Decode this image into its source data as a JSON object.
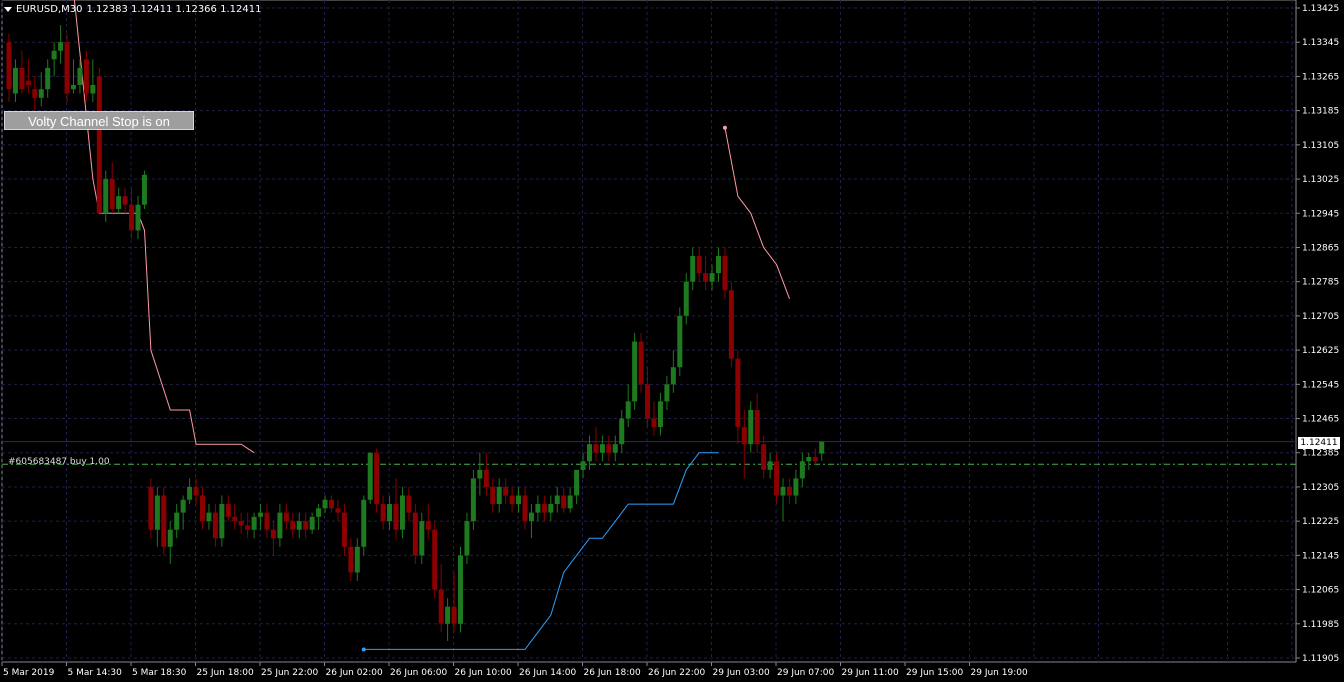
{
  "header": {
    "symbol": "EURUSD,M30",
    "ohlc": "1.12383 1.12411 1.12366 1.12411"
  },
  "indicator_button": {
    "label": "Volty Channel Stop is on"
  },
  "order": {
    "label": "#605683487 buy 1.00",
    "price": 1.12358
  },
  "current_price": {
    "label": "1.12411",
    "value": 1.12411
  },
  "colors": {
    "background": "#000000",
    "grid": "#202046",
    "bull": "#1e7a1e",
    "bear": "#8b0000",
    "upper_stop": "#ff9aa2",
    "lower_stop": "#2aa0ff",
    "order_line": "#4caf50",
    "price_line": "#2a2a6a",
    "axis_text": "#ffffff"
  },
  "chart_data": {
    "type": "candlestick",
    "symbol": "EURUSD",
    "timeframe": "M30",
    "ylim": [
      1.11885,
      1.13465
    ],
    "y_ticks": [
      "1.13425",
      "1.13345",
      "1.13265",
      "1.13185",
      "1.13105",
      "1.13025",
      "1.12945",
      "1.12865",
      "1.12785",
      "1.12705",
      "1.12625",
      "1.12545",
      "1.12465",
      "1.12385",
      "1.12305",
      "1.12225",
      "1.12145",
      "1.12065",
      "1.11985",
      "1.11905"
    ],
    "x_ticks": [
      "5 Mar 2019",
      "5 Mar 14:30",
      "5 Mar 18:30",
      "25 Jun 18:00",
      "25 Jun 22:00",
      "26 Jun 02:00",
      "26 Jun 06:00",
      "26 Jun 10:00",
      "26 Jun 14:00",
      "26 Jun 18:00",
      "26 Jun 22:00",
      "29 Jun 03:00",
      "29 Jun 07:00",
      "29 Jun 11:00",
      "29 Jun 15:00",
      "29 Jun 19:00"
    ],
    "grid": true,
    "candles": [
      [
        1.13345,
        1.13365,
        1.13205,
        1.13235
      ],
      [
        1.13225,
        1.13305,
        1.13205,
        1.13285
      ],
      [
        1.13285,
        1.13325,
        1.13225,
        1.13235
      ],
      [
        1.13255,
        1.13305,
        1.13225,
        1.13245
      ],
      [
        1.13235,
        1.13265,
        1.13185,
        1.13215
      ],
      [
        1.13215,
        1.13275,
        1.13195,
        1.13235
      ],
      [
        1.13235,
        1.13305,
        1.13215,
        1.13285
      ],
      [
        1.13305,
        1.13345,
        1.13265,
        1.13325
      ],
      [
        1.13325,
        1.13385,
        1.13295,
        1.13345
      ],
      [
        1.13345,
        1.13365,
        1.13205,
        1.13225
      ],
      [
        1.13235,
        1.13305,
        1.13225,
        1.13245
      ],
      [
        1.13245,
        1.13305,
        1.13225,
        1.13285
      ],
      [
        1.13305,
        1.13325,
        1.13205,
        1.13225
      ],
      [
        1.13225,
        1.13305,
        1.13205,
        1.13245
      ],
      [
        1.13265,
        1.13285,
        1.12945,
        1.12945
      ],
      [
        1.12945,
        1.13045,
        1.12925,
        1.13025
      ],
      [
        1.13025,
        1.13065,
        1.12945,
        1.12955
      ],
      [
        1.12955,
        1.13005,
        1.12945,
        1.12985
      ],
      [
        1.12985,
        1.13005,
        1.12945,
        1.12965
      ],
      [
        1.12965,
        1.13005,
        1.12885,
        1.12905
      ],
      [
        1.12905,
        1.12985,
        1.12885,
        1.12965
      ],
      [
        1.12965,
        1.13045,
        1.12955,
        1.13035
      ],
      [
        1.12305,
        1.12325,
        1.12185,
        1.12205
      ],
      [
        1.12205,
        1.12305,
        1.12165,
        1.12285
      ],
      [
        1.12285,
        1.12305,
        1.12145,
        1.12165
      ],
      [
        1.12165,
        1.12225,
        1.12125,
        1.12205
      ],
      [
        1.12205,
        1.12265,
        1.12185,
        1.12245
      ],
      [
        1.12245,
        1.12285,
        1.12205,
        1.12275
      ],
      [
        1.12275,
        1.12325,
        1.12265,
        1.12305
      ],
      [
        1.12305,
        1.12325,
        1.12265,
        1.12285
      ],
      [
        1.12285,
        1.12305,
        1.12205,
        1.12225
      ],
      [
        1.12225,
        1.12265,
        1.12205,
        1.12245
      ],
      [
        1.12245,
        1.12265,
        1.12165,
        1.12185
      ],
      [
        1.12185,
        1.12285,
        1.12165,
        1.12265
      ],
      [
        1.12265,
        1.12285,
        1.12225,
        1.12235
      ],
      [
        1.12235,
        1.12265,
        1.12205,
        1.12225
      ],
      [
        1.12225,
        1.12245,
        1.12195,
        1.12215
      ],
      [
        1.12215,
        1.12245,
        1.12185,
        1.12205
      ],
      [
        1.12205,
        1.12245,
        1.12185,
        1.12235
      ],
      [
        1.12235,
        1.12265,
        1.12205,
        1.12245
      ],
      [
        1.12245,
        1.12265,
        1.12185,
        1.12205
      ],
      [
        1.12205,
        1.12225,
        1.12145,
        1.12185
      ],
      [
        1.12185,
        1.12265,
        1.12165,
        1.12245
      ],
      [
        1.12245,
        1.12265,
        1.12205,
        1.12225
      ],
      [
        1.12225,
        1.12245,
        1.12185,
        1.12205
      ],
      [
        1.12205,
        1.12245,
        1.12185,
        1.12225
      ],
      [
        1.12225,
        1.12245,
        1.12185,
        1.12205
      ],
      [
        1.12205,
        1.12245,
        1.12195,
        1.12235
      ],
      [
        1.12235,
        1.12265,
        1.12205,
        1.12255
      ],
      [
        1.12255,
        1.12285,
        1.12245,
        1.12275
      ],
      [
        1.12275,
        1.12285,
        1.12245,
        1.12255
      ],
      [
        1.12255,
        1.12275,
        1.12225,
        1.12245
      ],
      [
        1.12245,
        1.12265,
        1.12145,
        1.12165
      ],
      [
        1.12165,
        1.12185,
        1.12085,
        1.12105
      ],
      [
        1.12105,
        1.12185,
        1.12085,
        1.12165
      ],
      [
        1.12165,
        1.12285,
        1.12145,
        1.12275
      ],
      [
        1.12275,
        1.12385,
        1.12265,
        1.12385
      ],
      [
        1.12385,
        1.12395,
        1.12245,
        1.12265
      ],
      [
        1.12265,
        1.12285,
        1.12205,
        1.12225
      ],
      [
        1.12225,
        1.12285,
        1.12205,
        1.12265
      ],
      [
        1.12265,
        1.12325,
        1.12185,
        1.12205
      ],
      [
        1.12205,
        1.12305,
        1.12185,
        1.12285
      ],
      [
        1.12285,
        1.12305,
        1.12225,
        1.12245
      ],
      [
        1.12245,
        1.12265,
        1.12125,
        1.12145
      ],
      [
        1.12145,
        1.12245,
        1.12125,
        1.12225
      ],
      [
        1.12225,
        1.12265,
        1.12185,
        1.12205
      ],
      [
        1.12205,
        1.12225,
        1.12045,
        1.12065
      ],
      [
        1.12065,
        1.12125,
        1.11965,
        1.11985
      ],
      [
        1.11985,
        1.12045,
        1.11945,
        1.12025
      ],
      [
        1.12025,
        1.12105,
        1.11965,
        1.11985
      ],
      [
        1.11985,
        1.12165,
        1.11965,
        1.12145
      ],
      [
        1.12145,
        1.12245,
        1.12125,
        1.12225
      ],
      [
        1.12225,
        1.12345,
        1.12205,
        1.12325
      ],
      [
        1.12325,
        1.12385,
        1.12285,
        1.12345
      ],
      [
        1.12345,
        1.12385,
        1.12285,
        1.12305
      ],
      [
        1.12305,
        1.12325,
        1.12245,
        1.12265
      ],
      [
        1.12265,
        1.12325,
        1.12245,
        1.12305
      ],
      [
        1.12305,
        1.12325,
        1.12265,
        1.12285
      ],
      [
        1.12285,
        1.12305,
        1.12245,
        1.12265
      ],
      [
        1.12265,
        1.12305,
        1.12245,
        1.12285
      ],
      [
        1.12285,
        1.12305,
        1.12205,
        1.12225
      ],
      [
        1.12225,
        1.12265,
        1.12185,
        1.12245
      ],
      [
        1.12245,
        1.12285,
        1.12225,
        1.12265
      ],
      [
        1.12265,
        1.12285,
        1.12225,
        1.12245
      ],
      [
        1.12245,
        1.12285,
        1.12225,
        1.12265
      ],
      [
        1.12265,
        1.12305,
        1.12245,
        1.12285
      ],
      [
        1.12285,
        1.12305,
        1.12245,
        1.12255
      ],
      [
        1.12255,
        1.12305,
        1.12245,
        1.12285
      ],
      [
        1.12285,
        1.12345,
        1.12265,
        1.12345
      ],
      [
        1.12345,
        1.12385,
        1.12325,
        1.12365
      ],
      [
        1.12365,
        1.12425,
        1.12345,
        1.12405
      ],
      [
        1.12405,
        1.12445,
        1.12365,
        1.12385
      ],
      [
        1.12385,
        1.12425,
        1.12365,
        1.12405
      ],
      [
        1.12405,
        1.12425,
        1.12365,
        1.12385
      ],
      [
        1.12385,
        1.12425,
        1.12365,
        1.12405
      ],
      [
        1.12405,
        1.12485,
        1.12385,
        1.12465
      ],
      [
        1.12465,
        1.12545,
        1.12445,
        1.12505
      ],
      [
        1.12505,
        1.12665,
        1.12485,
        1.12645
      ],
      [
        1.12645,
        1.12665,
        1.12525,
        1.12545
      ],
      [
        1.12545,
        1.12585,
        1.12445,
        1.12465
      ],
      [
        1.12465,
        1.12505,
        1.12425,
        1.12445
      ],
      [
        1.12445,
        1.12525,
        1.12425,
        1.12505
      ],
      [
        1.12505,
        1.12565,
        1.12485,
        1.12545
      ],
      [
        1.12545,
        1.12625,
        1.12525,
        1.12585
      ],
      [
        1.12585,
        1.12725,
        1.12565,
        1.12705
      ],
      [
        1.12705,
        1.12805,
        1.12685,
        1.12785
      ],
      [
        1.12785,
        1.12865,
        1.12765,
        1.12845
      ],
      [
        1.12845,
        1.12865,
        1.12785,
        1.12805
      ],
      [
        1.12805,
        1.12845,
        1.12765,
        1.12785
      ],
      [
        1.12785,
        1.12825,
        1.12765,
        1.12805
      ],
      [
        1.12805,
        1.12865,
        1.12785,
        1.12845
      ],
      [
        1.12845,
        1.12865,
        1.12745,
        1.12765
      ],
      [
        1.12765,
        1.12785,
        1.12585,
        1.12605
      ],
      [
        1.12605,
        1.12625,
        1.12405,
        1.12445
      ],
      [
        1.12445,
        1.12485,
        1.12325,
        1.12405
      ],
      [
        1.12405,
        1.12505,
        1.12385,
        1.12485
      ],
      [
        1.12485,
        1.12525,
        1.12385,
        1.12405
      ],
      [
        1.12405,
        1.12425,
        1.12325,
        1.12345
      ],
      [
        1.12345,
        1.12385,
        1.12325,
        1.12365
      ],
      [
        1.12365,
        1.12385,
        1.12265,
        1.12285
      ],
      [
        1.12285,
        1.12325,
        1.12225,
        1.12305
      ],
      [
        1.12305,
        1.12325,
        1.12265,
        1.12285
      ],
      [
        1.12285,
        1.12345,
        1.12265,
        1.12325
      ],
      [
        1.12325,
        1.12385,
        1.12305,
        1.12365
      ],
      [
        1.12365,
        1.12385,
        1.12345,
        1.12375
      ],
      [
        1.12375,
        1.12395,
        1.12355,
        1.12365
      ],
      [
        1.12383,
        1.12411,
        1.12366,
        1.12411
      ]
    ],
    "upper_stop": [
      [
        0,
        1.13745
      ],
      [
        10,
        1.13465
      ],
      [
        13,
        1.13025
      ],
      [
        14,
        1.12945
      ],
      [
        20,
        1.12945
      ],
      [
        21,
        1.12905
      ],
      [
        22,
        1.12625
      ],
      [
        25,
        1.12485
      ],
      [
        28,
        1.12485
      ],
      [
        29,
        1.12405
      ],
      [
        36,
        1.12405
      ],
      [
        38,
        1.12385
      ],
      [
        null,
        null
      ],
      [
        111,
        1.13145
      ],
      [
        113,
        1.12985
      ],
      [
        115,
        1.12945
      ],
      [
        117,
        1.12865
      ],
      [
        119,
        1.12825
      ],
      [
        121,
        1.12745
      ]
    ],
    "lower_stop": [
      [
        55,
        1.11925
      ],
      [
        80,
        1.11925
      ],
      [
        82,
        1.11965
      ],
      [
        84,
        1.12005
      ],
      [
        86,
        1.12105
      ],
      [
        88,
        1.12145
      ],
      [
        90,
        1.12185
      ],
      [
        92,
        1.12185
      ],
      [
        94,
        1.12225
      ],
      [
        96,
        1.12265
      ],
      [
        103,
        1.12265
      ],
      [
        105,
        1.12345
      ],
      [
        107,
        1.12385
      ],
      [
        110,
        1.12385
      ]
    ]
  }
}
